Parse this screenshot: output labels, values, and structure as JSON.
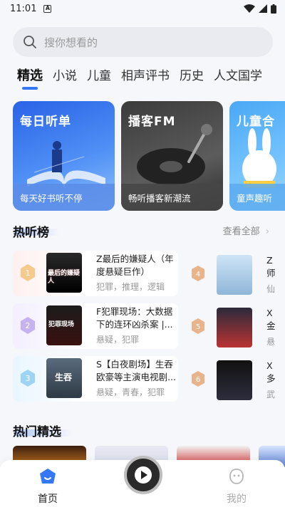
{
  "status_bar": {
    "time": "11:01",
    "notification_icon": "A"
  },
  "search": {
    "placeholder": "搜你想看的"
  },
  "tabs": [
    {
      "label": "精选",
      "active": true
    },
    {
      "label": "小说"
    },
    {
      "label": "儿童"
    },
    {
      "label": "相声评书"
    },
    {
      "label": "历史"
    },
    {
      "label": "人文国学"
    }
  ],
  "banners": [
    {
      "title": "每日听单",
      "subtitle": "每天好书听不停"
    },
    {
      "title": "播客FM",
      "subtitle": "畅听播客新潮流"
    },
    {
      "title": "儿童合",
      "subtitle": "童声趣听"
    }
  ],
  "hot_list": {
    "title": "热听榜",
    "see_all": "查看全部",
    "left": [
      {
        "rank": "1",
        "title": "Z最后的嫌疑人（年度悬疑巨作）",
        "tags": "犯罪，推理，逻辑",
        "cover_text": "最后的嫌疑人"
      },
      {
        "rank": "2",
        "title": "F犯罪现场：大数据下的连环凶杀案 |...",
        "tags": "悬疑，犯罪",
        "cover_text": "犯罪现场"
      },
      {
        "rank": "3",
        "title": "S【白夜剧场】生吞 欧豪等主演电视剧...",
        "tags": "悬疑，青春，犯罪",
        "cover_text": "生吞"
      }
    ],
    "right": [
      {
        "rank": "4",
        "title": "Z 师",
        "tags": "仙"
      },
      {
        "rank": "5",
        "title": "X 金",
        "tags": "悬"
      },
      {
        "rank": "6",
        "title": "X 多",
        "tags": "武"
      }
    ]
  },
  "featured": {
    "title": "热门精选"
  },
  "bottom_nav": {
    "home_label": "首页",
    "me_label": "我的"
  },
  "colors": {
    "accent": "#3478f6",
    "background": "#f6f7fb"
  }
}
